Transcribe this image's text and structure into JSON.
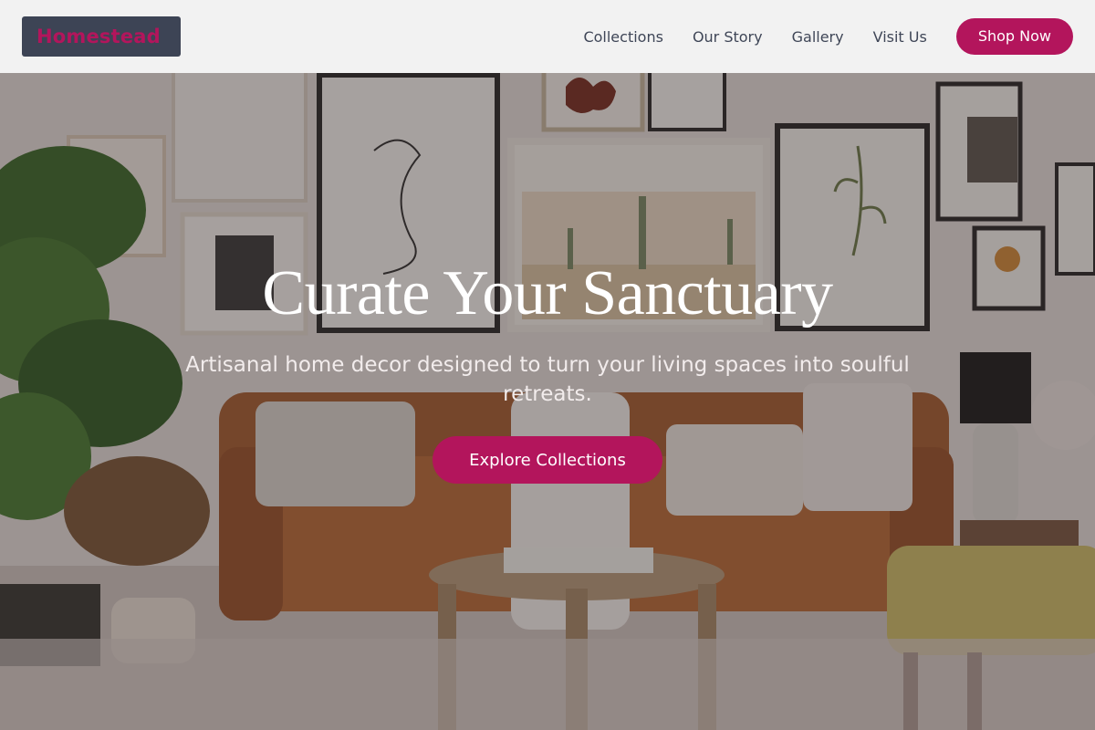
{
  "brand": {
    "name": "Homestead",
    "accent_color": "#b3155c",
    "logo_bg_color": "#3d4455"
  },
  "nav": {
    "links": [
      "Collections",
      "Our Story",
      "Gallery",
      "Visit Us"
    ],
    "cta_label": "Shop Now"
  },
  "hero": {
    "title": "Curate Your Sanctuary",
    "subtitle": "Artisanal home decor designed to turn your living spaces into soulful retreats.",
    "cta_label": "Explore Collections",
    "background_description_icon": "living-room-photo"
  }
}
